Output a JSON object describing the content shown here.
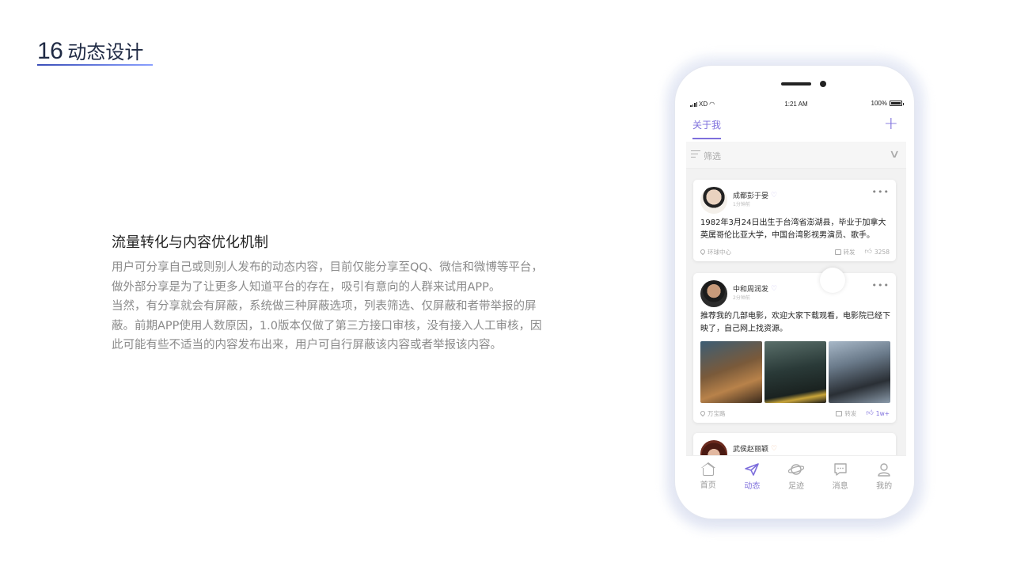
{
  "slide": {
    "number": "16",
    "title": "动态设计"
  },
  "description": {
    "heading": "流量转化与内容优化机制",
    "line1": "用户可分享自己或则别人发布的动态内容，目前仅能分享至QQ、微信和微博等平台，",
    "line2": "做外部分享是为了让更多人知道平台的存在，吸引有意向的人群来试用APP。",
    "line3": "当然，有分享就会有屏蔽，系统做三种屏蔽选项，列表筛选、仅屏蔽和者带举报的屏",
    "line4": "蔽。前期APP使用人数原因，1.0版本仅做了第三方接口审核，没有接入人工审核，因",
    "line5": "此可能有些不适当的内容发布出来，用户可自行屏蔽该内容或者举报该内容。"
  },
  "statusbar": {
    "carrier": "XD",
    "time": "1:21 AM",
    "battery": "100%"
  },
  "topbar": {
    "tab": "关于我",
    "plus": "+"
  },
  "filter": {
    "label": "筛选",
    "chevron": "∨"
  },
  "posts": [
    {
      "name": "成都彭于晏",
      "time": "1分钟前",
      "text": "1982年3月24日出生于台湾省澎湖县，毕业于加拿大英属哥伦比亚大学，中国台湾影视男演员、歌手。",
      "location": "环球中心",
      "share": "转发",
      "likes": "3258"
    },
    {
      "name": "中和周润发",
      "time": "2分钟前",
      "text": "推荐我的几部电影，欢迎大家下载观看，电影院已经下映了，自己网上找资源。",
      "location": "万宝路",
      "share": "转发",
      "likes": "1w+"
    },
    {
      "name": "武侯赵丽颖"
    }
  ],
  "tabs": [
    {
      "label": "首页",
      "icon": "home-icon"
    },
    {
      "label": "动态",
      "icon": "send-icon"
    },
    {
      "label": "足迹",
      "icon": "planet-icon"
    },
    {
      "label": "消息",
      "icon": "message-icon"
    },
    {
      "label": "我的",
      "icon": "user-icon"
    }
  ],
  "colors": {
    "accent": "#7e6fdc",
    "title": "#1f2a44",
    "body_text": "#8a8a8a"
  }
}
